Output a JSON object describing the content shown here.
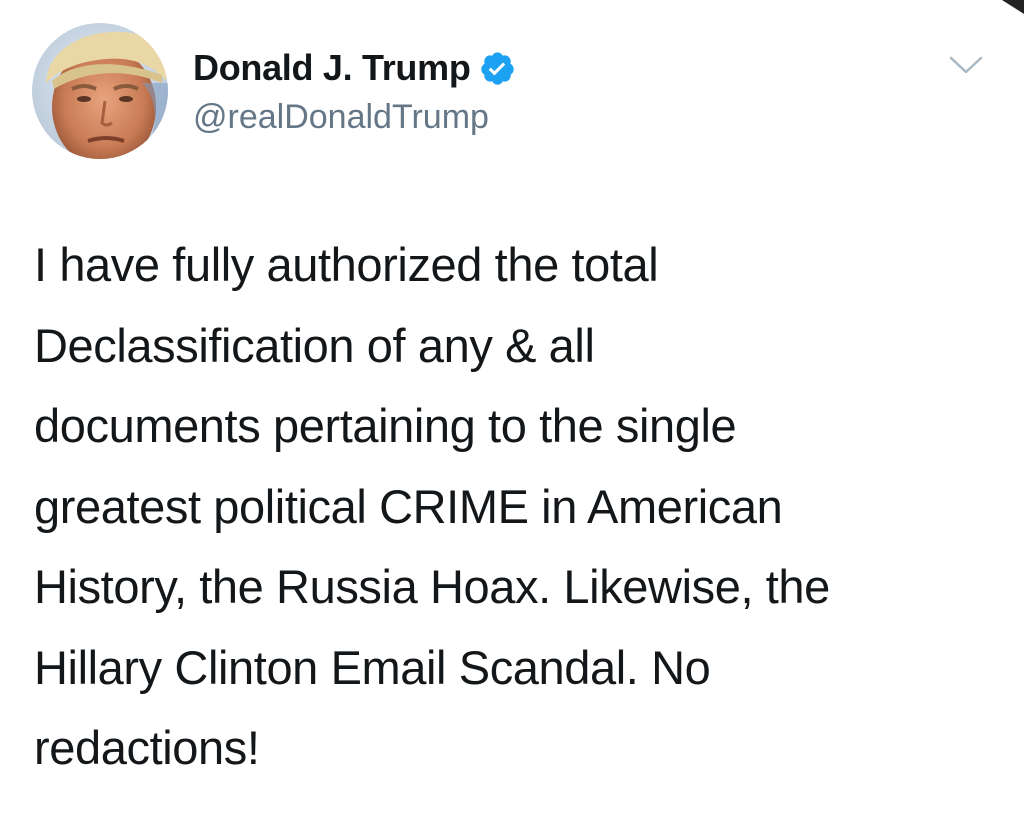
{
  "author": {
    "display_name": "Donald J. Trump",
    "handle": "@realDonaldTrump",
    "verified": true,
    "avatar_icon": "profile-photo",
    "verified_icon": "verified-badge-icon",
    "menu_icon": "chevron-down-icon"
  },
  "tweet": {
    "lines": [
      "I have fully authorized the total",
      "Declassification of any & all",
      "documents pertaining to the single",
      "greatest political CRIME in American",
      "History, the Russia Hoax. Likewise, the",
      "Hillary Clinton Email Scandal. No",
      "redactions!"
    ]
  },
  "colors": {
    "text": "#14171a",
    "secondary": "#657786",
    "verified": "#1da1f2",
    "chevron": "#aab8c2"
  }
}
